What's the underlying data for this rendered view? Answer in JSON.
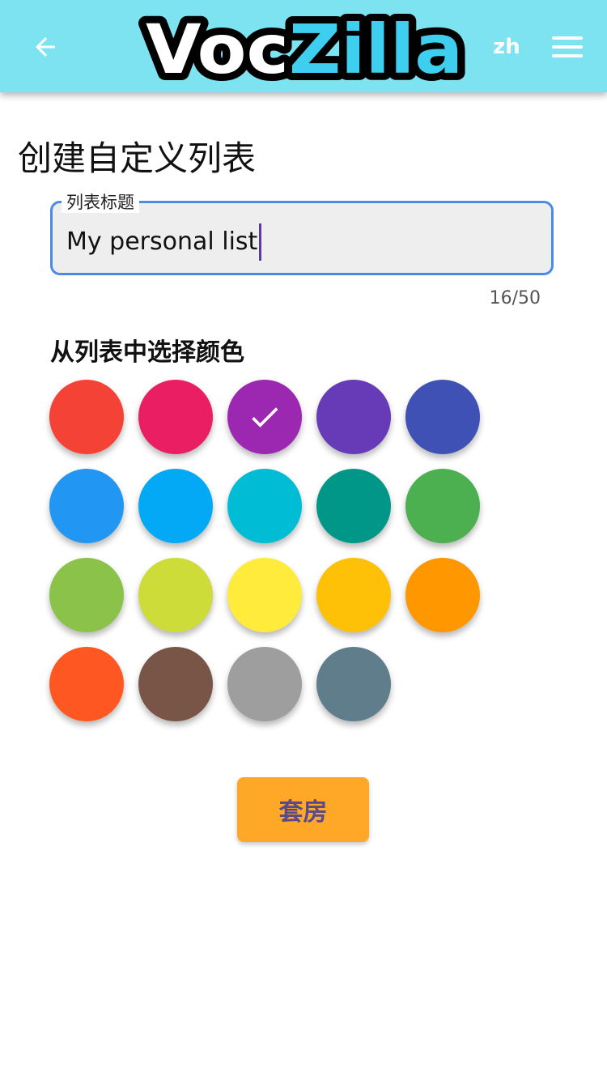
{
  "app": {
    "logo": {
      "part1": "Voc",
      "part2": "Zilla"
    },
    "language": "zh",
    "icons": {
      "back": "arrow-left-icon",
      "menu": "hamburger-menu-icon"
    }
  },
  "page": {
    "title": "创建自定义列表",
    "title_field": {
      "label": "列表标题",
      "value": "My personal list",
      "counter": "16/50"
    },
    "color_section_label": "从列表中选择颜色",
    "colors": [
      {
        "name": "red",
        "hex": "#f44336",
        "selected": false
      },
      {
        "name": "pink",
        "hex": "#e91e63",
        "selected": false
      },
      {
        "name": "purple",
        "hex": "#9c27b0",
        "selected": true
      },
      {
        "name": "deep-purple",
        "hex": "#673ab7",
        "selected": false
      },
      {
        "name": "indigo",
        "hex": "#3f51b5",
        "selected": false
      },
      {
        "name": "blue",
        "hex": "#2196f3",
        "selected": false
      },
      {
        "name": "light-blue",
        "hex": "#03a9f4",
        "selected": false
      },
      {
        "name": "cyan",
        "hex": "#00bcd4",
        "selected": false
      },
      {
        "name": "teal",
        "hex": "#009688",
        "selected": false
      },
      {
        "name": "green",
        "hex": "#4caf50",
        "selected": false
      },
      {
        "name": "light-green",
        "hex": "#8bc34a",
        "selected": false
      },
      {
        "name": "lime",
        "hex": "#cddc39",
        "selected": false
      },
      {
        "name": "yellow",
        "hex": "#ffeb3b",
        "selected": false
      },
      {
        "name": "amber",
        "hex": "#ffc107",
        "selected": false
      },
      {
        "name": "orange",
        "hex": "#ff9800",
        "selected": false
      },
      {
        "name": "deep-orange",
        "hex": "#ff5722",
        "selected": false
      },
      {
        "name": "brown",
        "hex": "#795548",
        "selected": false
      },
      {
        "name": "grey",
        "hex": "#9e9e9e",
        "selected": false
      },
      {
        "name": "blue-grey",
        "hex": "#607d8b",
        "selected": false
      }
    ],
    "submit_label": "套房"
  },
  "theme": {
    "appbar": "#7ee3f1",
    "accent_blue": "#4b8be8",
    "button": "#ffa726"
  }
}
